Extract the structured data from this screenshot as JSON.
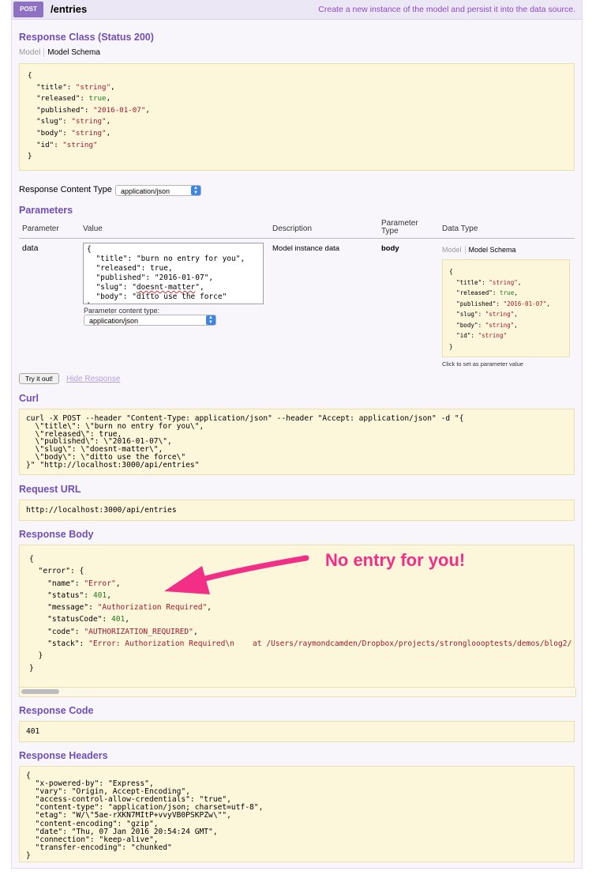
{
  "operation": {
    "method": "POST",
    "path": "/entries",
    "summary": "Create a new instance of the model and persist it into the data source."
  },
  "response_class": {
    "title": "Response Class (Status 200)",
    "tabs": [
      "Model",
      "Model Schema"
    ],
    "schema_lines": [
      [
        [
          "{",
          "k"
        ]
      ],
      [
        [
          "  \"title\": ",
          "k"
        ],
        [
          "\"string\"",
          "s"
        ],
        [
          ",",
          "k"
        ]
      ],
      [
        [
          "  \"released\": ",
          "k"
        ],
        [
          "true",
          "n"
        ],
        [
          ",",
          "k"
        ]
      ],
      [
        [
          "  \"published\": ",
          "k"
        ],
        [
          "\"2016-01-07\"",
          "s"
        ],
        [
          ",",
          "k"
        ]
      ],
      [
        [
          "  \"slug\": ",
          "k"
        ],
        [
          "\"string\"",
          "s"
        ],
        [
          ",",
          "k"
        ]
      ],
      [
        [
          "  \"body\": ",
          "k"
        ],
        [
          "\"string\"",
          "s"
        ],
        [
          ",",
          "k"
        ]
      ],
      [
        [
          "  \"id\": ",
          "k"
        ],
        [
          "\"string\"",
          "s"
        ]
      ],
      [
        [
          "}",
          "k"
        ]
      ]
    ]
  },
  "response_content_type": {
    "label": "Response Content Type",
    "selected": "application/json"
  },
  "parameters": {
    "title": "Parameters",
    "headers": {
      "parameter": "Parameter",
      "value": "Value",
      "description": "Description",
      "parameter_type": "Parameter\nType",
      "data_type": "Data Type"
    },
    "row": {
      "name": "data",
      "value_lines": [
        "{",
        "  \"title\": \"burn no entry for you\",",
        "  \"released\": true,",
        "  \"published\": \"2016-01-07\",",
        "  \"slug\": \"doesnt-matter\",",
        "  \"body\": \"ditto use the force\"",
        "}"
      ],
      "content_type_label": "Parameter content type:",
      "content_type_selected": "application/json",
      "description": "Model instance data",
      "parameter_type": "body",
      "data_type_tabs": [
        "Model",
        "Model Schema"
      ],
      "schema_lines": [
        [
          [
            "{",
            "k"
          ]
        ],
        [
          [
            "  \"title\": ",
            "k"
          ],
          [
            "\"string\"",
            "s"
          ],
          [
            ",",
            "k"
          ]
        ],
        [
          [
            "  \"released\": ",
            "k"
          ],
          [
            "true",
            "n"
          ],
          [
            ",",
            "k"
          ]
        ],
        [
          [
            "  \"published\": ",
            "k"
          ],
          [
            "\"2016-01-07\"",
            "s"
          ],
          [
            ",",
            "k"
          ]
        ],
        [
          [
            "  \"slug\": ",
            "k"
          ],
          [
            "\"string\"",
            "s"
          ],
          [
            ",",
            "k"
          ]
        ],
        [
          [
            "  \"body\": ",
            "k"
          ],
          [
            "\"string\"",
            "s"
          ],
          [
            ",",
            "k"
          ]
        ],
        [
          [
            "  \"id\": ",
            "k"
          ],
          [
            "\"string\"",
            "s"
          ]
        ],
        [
          [
            "}",
            "k"
          ]
        ]
      ],
      "schema_hint": "Click to set as parameter value"
    }
  },
  "actions": {
    "try_it": "Try it out!",
    "hide_response": "Hide Response"
  },
  "curl": {
    "title": "Curl",
    "text": "curl -X POST --header \"Content-Type: application/json\" --header \"Accept: application/json\" -d \"{\n  \\\"title\\\": \\\"burn no entry for you\\\",\n  \\\"released\\\": true,\n  \\\"published\\\": \\\"2016-01-07\\\",\n  \\\"slug\\\": \\\"doesnt-matter\\\",\n  \\\"body\\\": \\\"ditto use the force\\\"\n}\" \"http://localhost:3000/api/entries\""
  },
  "request_url": {
    "title": "Request URL",
    "value": "http://localhost:3000/api/entries"
  },
  "response_body": {
    "title": "Response Body",
    "lines": [
      [
        [
          "{",
          "k"
        ]
      ],
      [
        [
          "  \"error\": {",
          "k"
        ]
      ],
      [
        [
          "    \"name\": ",
          "k"
        ],
        [
          "\"Error\"",
          "s"
        ],
        [
          ",",
          "k"
        ]
      ],
      [
        [
          "    \"status\": ",
          "k"
        ],
        [
          "401",
          "n"
        ],
        [
          ",",
          "k"
        ]
      ],
      [
        [
          "    \"message\": ",
          "k"
        ],
        [
          "\"Authorization Required\"",
          "s"
        ],
        [
          ",",
          "k"
        ]
      ],
      [
        [
          "    \"statusCode\": ",
          "k"
        ],
        [
          "401",
          "n"
        ],
        [
          ",",
          "k"
        ]
      ],
      [
        [
          "    \"code\": ",
          "k"
        ],
        [
          "\"AUTHORIZATION_REQUIRED\"",
          "s"
        ],
        [
          ",",
          "k"
        ]
      ],
      [
        [
          "    \"stack\": ",
          "k"
        ],
        [
          "\"Error: Authorization Required\\n    at /Users/raymondcamden/Dropbox/projects/strongloooptests/demos/blog2/",
          "s"
        ]
      ],
      [
        [
          "  }",
          "k"
        ]
      ],
      [
        [
          "}",
          "k"
        ]
      ]
    ]
  },
  "annotation": {
    "text": "No entry for you!",
    "color": "#f22e86"
  },
  "response_code": {
    "title": "Response Code",
    "value": "401"
  },
  "response_headers": {
    "title": "Response Headers",
    "text": "{\n  \"x-powered-by\": \"Express\",\n  \"vary\": \"Origin, Accept-Encoding\",\n  \"access-control-allow-credentials\": \"true\",\n  \"content-type\": \"application/json; charset=utf-8\",\n  \"etag\": \"W/\\\"5ae-rXKN7MItP+vvyVB0PSKPZw\\\"\",\n  \"content-encoding\": \"gzip\",\n  \"date\": \"Thu, 07 Jan 2016 20:54:24 GMT\",\n  \"connection\": \"keep-alive\",\n  \"transfer-encoding\": \"chunked\"\n}"
  },
  "colors": {
    "accent": "#8f71c4",
    "section_title": "#6f4fb7",
    "code_background": "#fcf6db"
  }
}
